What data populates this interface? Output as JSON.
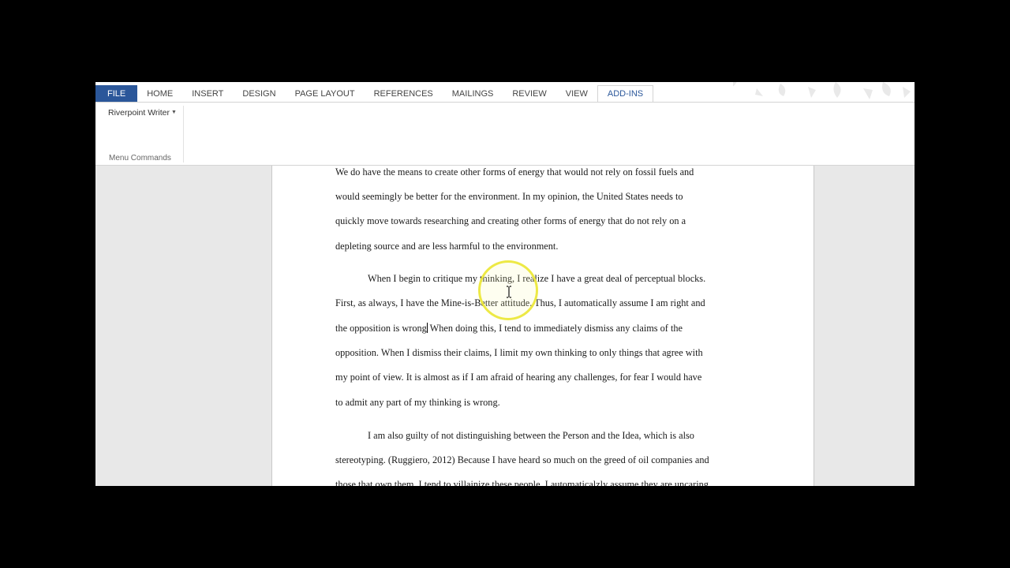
{
  "tabs": [
    "FILE",
    "HOME",
    "INSERT",
    "DESIGN",
    "PAGE LAYOUT",
    "REFERENCES",
    "MAILINGS",
    "REVIEW",
    "VIEW",
    "ADD-INS"
  ],
  "active_tab": "ADD-INS",
  "ribbon": {
    "dropdown_label": "Riverpoint Writer",
    "group_label": "Menu Commands"
  },
  "document": {
    "lines": [
      "We do have the means to create other forms of energy that would not rely on fossil fuels and",
      "would seemingly be better for the environment.  In my opinion, the United States needs to",
      "quickly move towards researching and creating other forms of energy that do not rely on a",
      "depleting source and are less harmful to the environment.",
      "When I begin to critique my thinking, I realize I have a great deal of perceptual blocks.",
      "First, as always, I have the Mine-is-Better attitude.  Thus, I automatically assume I am right and",
      "the opposition is wrong",
      " When doing this, I tend to immediately dismiss any claims of the",
      "opposition.  When I dismiss their claims, I limit my own thinking to only things that agree with",
      "my point of view.  It is almost as if I am afraid of hearing any challenges, for fear I would have",
      "to admit any part of my thinking is wrong.",
      "I am also guilty of not distinguishing between the Person and the Idea, which is also",
      "stereotyping. (Ruggiero, 2012)  Because I have heard so much on the greed of oil companies and",
      "those that own them, I tend to villainize these people.  I automaticalzly assume they are uncaring"
    ]
  },
  "icons": {
    "cursor": "i-beam-cursor-icon",
    "highlight": "cursor-highlight-ring",
    "dropdown": "chevron-down-icon"
  },
  "colors": {
    "file_tab": "#2b579a",
    "highlight": "#ece83c"
  }
}
